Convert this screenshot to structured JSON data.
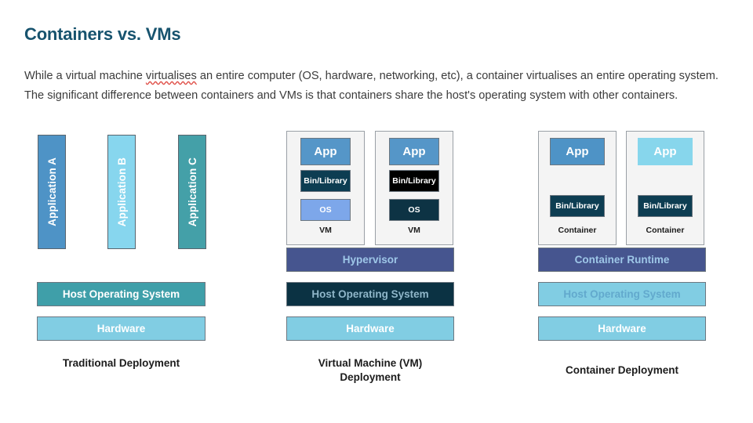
{
  "page_title": "Containers vs. VMs",
  "intro": {
    "part1": "While a virtual machine ",
    "misspelled1": "virtualises",
    "part2": " an entire computer (OS, hardware, networking, etc), a container virtualises an entire operating system. The significant difference between containers and VMs is that containers share the host's operating system with other containers."
  },
  "colors": {
    "title": "#17536e",
    "app_a": "#4e93c6",
    "app_b": "#87d6ee",
    "app_c": "#44a0a8",
    "host_os_teal": "#3f9fa9",
    "hardware_light": "#81cde3",
    "app_steel": "#5596c8",
    "bin_navy": "#0d3d52",
    "bin_black": "#000000",
    "os_periwinkle": "#7da7ea",
    "os_navy": "#0d3344",
    "hypervisor_slate": "#46558f",
    "host_os_navy": "#0b3243",
    "container_app_light": "#87d6ec",
    "panel_bg": "#f4f4f4"
  },
  "columns": {
    "traditional": {
      "caption": "Traditional Deployment",
      "apps": [
        {
          "label": "Application A",
          "color": "#4e93c6"
        },
        {
          "label": "Application B",
          "color": "#87d6ee"
        },
        {
          "label": "Application C",
          "color": "#44a0a8"
        }
      ],
      "host_os": {
        "label": "Host Operating System",
        "color": "#3f9fa9",
        "text_color": "#ffffff"
      },
      "hardware": {
        "label": "Hardware",
        "color": "#81cde3",
        "text_color": "#ffffff"
      }
    },
    "vm": {
      "caption_line1": "Virtual Machine (VM)",
      "caption_line2": "Deployment",
      "vms": [
        {
          "panel_label": "VM",
          "app": {
            "label": "App",
            "color": "#5596c8",
            "text_color": "#ffffff"
          },
          "bin": {
            "label": "Bin/Library",
            "color": "#0d3d52",
            "text_color": "#ffffff"
          },
          "os": {
            "label": "OS",
            "color": "#7da7ea",
            "text_color": "#ffffff"
          }
        },
        {
          "panel_label": "VM",
          "app": {
            "label": "App",
            "color": "#5596c8",
            "text_color": "#ffffff"
          },
          "bin": {
            "label": "Bin/Library",
            "color": "#000000",
            "text_color": "#ffffff"
          },
          "os": {
            "label": "OS",
            "color": "#0d3344",
            "text_color": "#ffffff"
          }
        }
      ],
      "hypervisor": {
        "label": "Hypervisor",
        "color": "#46558f",
        "text_color": "#9ec7e8"
      },
      "host_os": {
        "label": "Host Operating System",
        "color": "#0b3243",
        "text_color": "#8fb6c9"
      },
      "hardware": {
        "label": "Hardware",
        "color": "#81cde3",
        "text_color": "#ffffff"
      }
    },
    "container": {
      "caption": "Container Deployment",
      "containers": [
        {
          "panel_label": "Container",
          "app": {
            "label": "App",
            "color": "#4e93c6",
            "text_color": "#ffffff"
          },
          "bin": {
            "label": "Bin/Library",
            "color": "#0d3d52",
            "text_color": "#ffffff"
          }
        },
        {
          "panel_label": "Container",
          "app": {
            "label": "App",
            "color": "#87d6ec",
            "text_color": "#ffffff"
          },
          "bin": {
            "label": "Bin/Library",
            "color": "#0d3d52",
            "text_color": "#ffffff"
          }
        }
      ],
      "runtime": {
        "label": "Container Runtime",
        "color": "#46558f",
        "text_color": "#9ec7e8"
      },
      "host_os": {
        "label": "Host Operating System",
        "color": "#81cde3",
        "text_color": "#62a9cd"
      },
      "hardware": {
        "label": "Hardware",
        "color": "#81cde3",
        "text_color": "#ffffff"
      }
    }
  }
}
